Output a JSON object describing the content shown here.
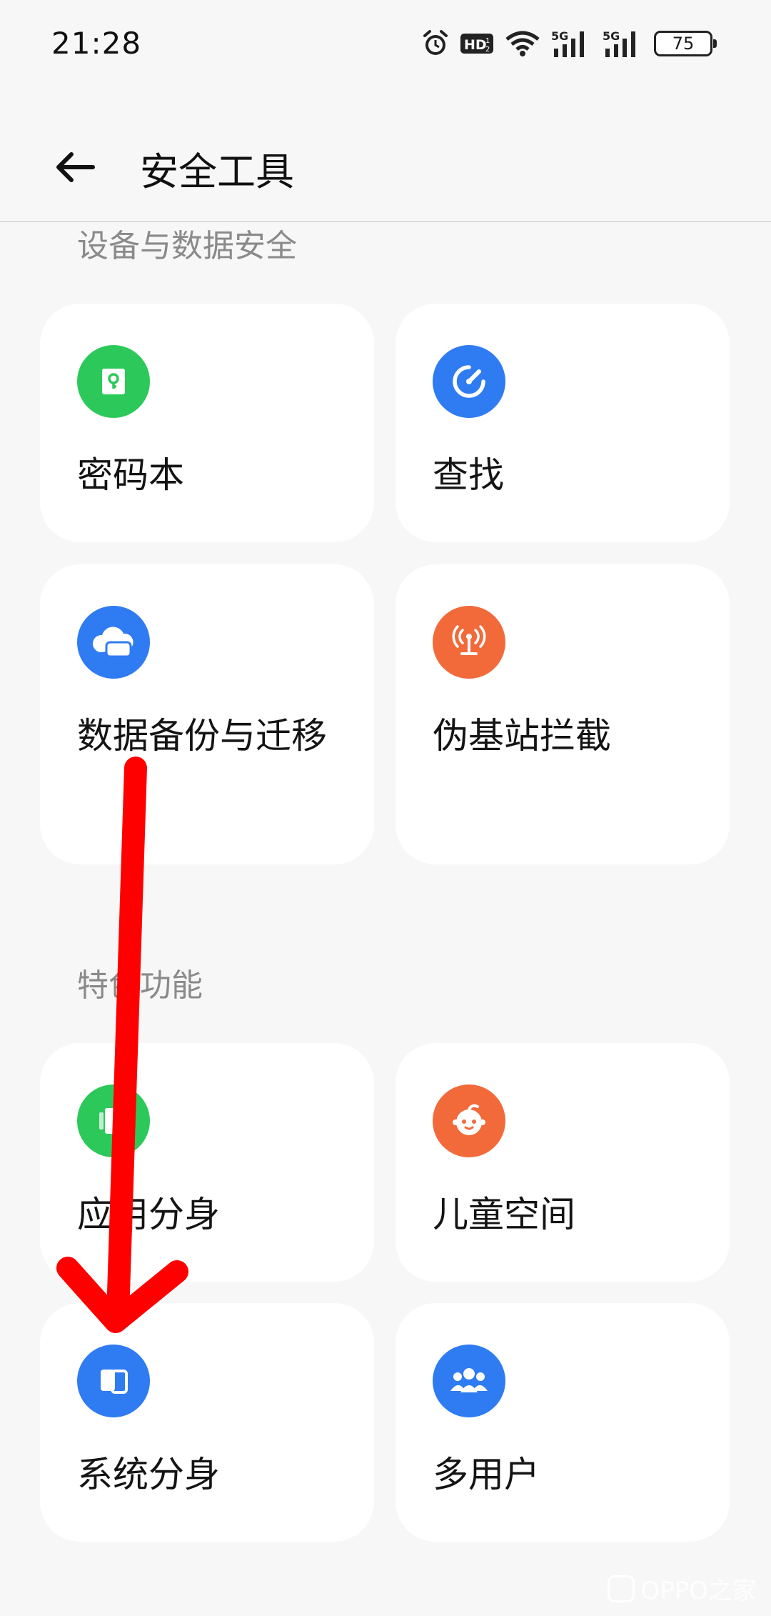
{
  "status_bar": {
    "time": "21:28",
    "battery": "75",
    "icons": [
      "alarm-icon",
      "hd-icon",
      "wifi-icon",
      "5g-signal-icon",
      "5g-signal-icon",
      "battery-icon"
    ]
  },
  "header": {
    "title": "安全工具",
    "back_icon": "back-arrow-icon"
  },
  "sections": [
    {
      "label": "设备与数据安全",
      "items": [
        {
          "label": "密码本",
          "icon": "keyhole-icon",
          "color": "#2cc95a"
        },
        {
          "label": "查找",
          "icon": "find-device-icon",
          "color": "#2f7bf2"
        },
        {
          "label": "数据备份与迁移",
          "icon": "cloud-backup-icon",
          "color": "#2f7bf2"
        },
        {
          "label": "伪基站拦截",
          "icon": "antenna-icon",
          "color": "#f26a3a"
        }
      ]
    },
    {
      "label": "特色功能",
      "items": [
        {
          "label": "应用分身",
          "icon": "app-clone-icon",
          "color": "#2cc95a"
        },
        {
          "label": "儿童空间",
          "icon": "child-face-icon",
          "color": "#f26a3a"
        },
        {
          "label": "系统分身",
          "icon": "system-clone-icon",
          "color": "#2f7bf2"
        },
        {
          "label": "多用户",
          "icon": "users-icon",
          "color": "#2f7bf2"
        }
      ]
    }
  ],
  "annotation": {
    "arrow_color": "#ff0000"
  },
  "watermark": {
    "text": "OPPO之家"
  }
}
